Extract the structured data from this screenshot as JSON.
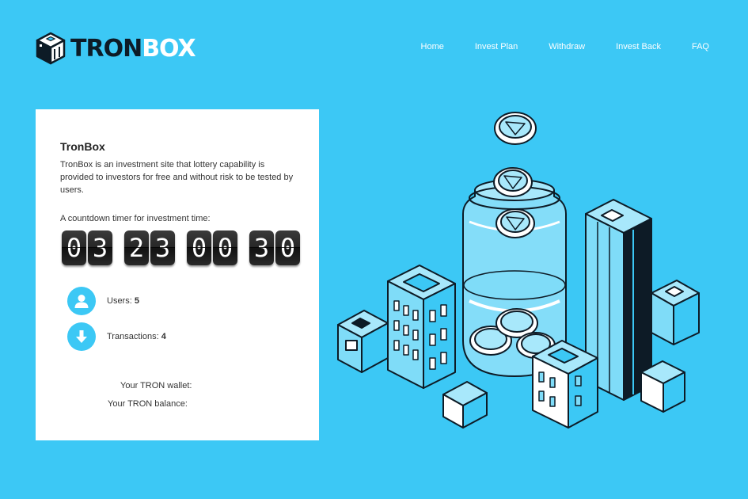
{
  "header": {
    "logo_part1": "TRON",
    "logo_part2": "BOX",
    "nav": [
      "Home",
      "Invest Plan",
      "Withdraw",
      "Invest Back",
      "FAQ"
    ]
  },
  "card": {
    "title": "TronBox",
    "description": "TronBox is an investment site that lottery capability is provided to investors for free and without risk to be tested by users.",
    "timer_label": "A countdown timer for investment time:",
    "countdown": [
      "03",
      "23",
      "00",
      "30"
    ],
    "users_label": "Users:",
    "users_value": "5",
    "transactions_label": "Transactions:",
    "transactions_value": "4",
    "wallet_label": "Your TRON wallet:",
    "balance_label": "Your TRON balance:"
  },
  "colors": {
    "background": "#3cc8f5",
    "card": "#ffffff",
    "logo_dark": "#0d1b26",
    "illustration_fill": "#7fdcf8"
  },
  "icons": [
    "box-logo-icon",
    "user-icon",
    "arrow-down-icon",
    "coin-icon"
  ]
}
